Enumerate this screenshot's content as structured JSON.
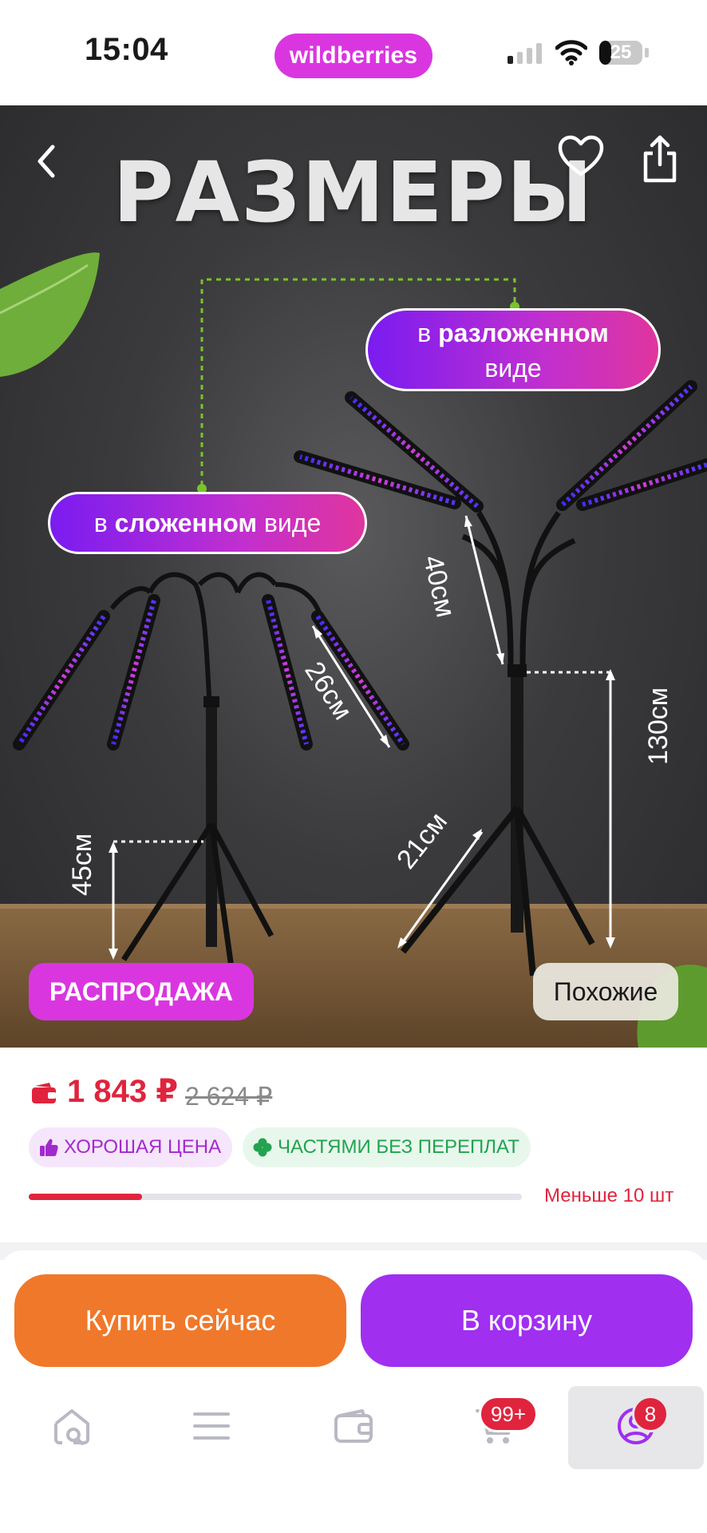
{
  "status_bar": {
    "time": "15:04",
    "brand": "wildberries",
    "battery_level": "25",
    "icons": [
      "signal-icon",
      "wifi-icon",
      "battery-icon"
    ]
  },
  "product_image": {
    "title": "РАЗМЕРЫ",
    "unfolded_prefix": "в",
    "unfolded_bold": "разложенном",
    "unfolded_suffix": "виде",
    "folded_prefix": "в",
    "folded_bold": "сложенном",
    "folded_suffix": "виде",
    "dims": {
      "arm_length": "26см",
      "stand_folded": "45см",
      "neck": "40см",
      "stand_unfolded": "130см",
      "leg": "21см"
    },
    "badge_sale": "РАСПРОДАЖА",
    "badge_similar": "Похожие",
    "nav_icons": [
      "back-icon",
      "heart-icon",
      "share-icon"
    ]
  },
  "price": {
    "current": "1 843 ₽",
    "old": "2 624 ₽",
    "tag_good": "ХОРОШАЯ ЦЕНА",
    "tag_parts": "ЧАСТЯМИ БЕЗ ПЕРЕПЛАТ",
    "stock_label": "Меньше 10 шт",
    "stock_fraction": 0.23
  },
  "actions": {
    "buy_now": "Купить сейчас",
    "add_to_cart": "В корзину"
  },
  "tab_bar": {
    "cart_count": "99+",
    "profile_count": "8",
    "icons": [
      "home-search-icon",
      "menu-icon",
      "wallet-icon",
      "cart-icon",
      "profile-icon"
    ]
  },
  "colors": {
    "brand": "#d936e0",
    "price_red": "#e0243d",
    "buy_now": "#f0782a",
    "add_to_cart": "#a02ff0"
  }
}
